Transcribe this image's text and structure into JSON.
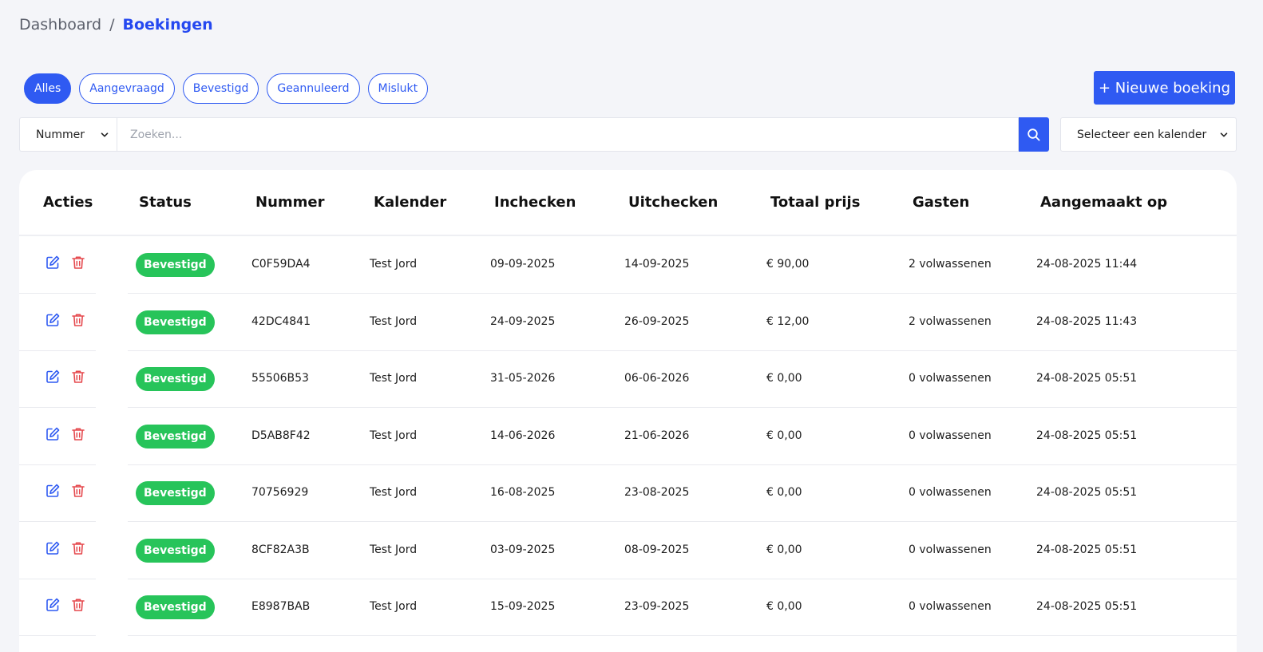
{
  "breadcrumb": {
    "root": "Dashboard",
    "separator": "/",
    "current": "Boekingen"
  },
  "filters": [
    {
      "label": "Alles",
      "active": true
    },
    {
      "label": "Aangevraagd",
      "active": false
    },
    {
      "label": "Bevestigd",
      "active": false
    },
    {
      "label": "Geannuleerd",
      "active": false
    },
    {
      "label": "Mislukt",
      "active": false
    }
  ],
  "new_booking_label": "+ Nieuwe boeking",
  "search": {
    "field_value": "Nummer",
    "placeholder": "Zoeken...",
    "calendar_value": "Selecteer een kalender"
  },
  "colors": {
    "accent": "#2f5af2",
    "status_green": "#27c45a",
    "delete_red": "#e5484d"
  },
  "table": {
    "headers": [
      "Acties",
      "Status",
      "Nummer",
      "Kalender",
      "Inchecken",
      "Uitchecken",
      "Totaal prijs",
      "Gasten",
      "Aangemaakt op"
    ],
    "rows": [
      {
        "status": "Bevestigd",
        "nummer": "C0F59DA4",
        "kalender": "Test Jord",
        "inchecken": "09-09-2025",
        "uitchecken": "14-09-2025",
        "prijs": "€ 90,00",
        "gasten": "2 volwassenen",
        "aangemaakt": "24-08-2025 11:44"
      },
      {
        "status": "Bevestigd",
        "nummer": "42DC4841",
        "kalender": "Test Jord",
        "inchecken": "24-09-2025",
        "uitchecken": "26-09-2025",
        "prijs": "€ 12,00",
        "gasten": "2 volwassenen",
        "aangemaakt": "24-08-2025 11:43"
      },
      {
        "status": "Bevestigd",
        "nummer": "55506B53",
        "kalender": "Test Jord",
        "inchecken": "31-05-2026",
        "uitchecken": "06-06-2026",
        "prijs": "€ 0,00",
        "gasten": "0 volwassenen",
        "aangemaakt": "24-08-2025 05:51"
      },
      {
        "status": "Bevestigd",
        "nummer": "D5AB8F42",
        "kalender": "Test Jord",
        "inchecken": "14-06-2026",
        "uitchecken": "21-06-2026",
        "prijs": "€ 0,00",
        "gasten": "0 volwassenen",
        "aangemaakt": "24-08-2025 05:51"
      },
      {
        "status": "Bevestigd",
        "nummer": "70756929",
        "kalender": "Test Jord",
        "inchecken": "16-08-2025",
        "uitchecken": "23-08-2025",
        "prijs": "€ 0,00",
        "gasten": "0 volwassenen",
        "aangemaakt": "24-08-2025 05:51"
      },
      {
        "status": "Bevestigd",
        "nummer": "8CF82A3B",
        "kalender": "Test Jord",
        "inchecken": "03-09-2025",
        "uitchecken": "08-09-2025",
        "prijs": "€ 0,00",
        "gasten": "0 volwassenen",
        "aangemaakt": "24-08-2025 05:51"
      },
      {
        "status": "Bevestigd",
        "nummer": "E8987BAB",
        "kalender": "Test Jord",
        "inchecken": "15-09-2025",
        "uitchecken": "23-09-2025",
        "prijs": "€ 0,00",
        "gasten": "0 volwassenen",
        "aangemaakt": "24-08-2025 05:51"
      }
    ]
  }
}
